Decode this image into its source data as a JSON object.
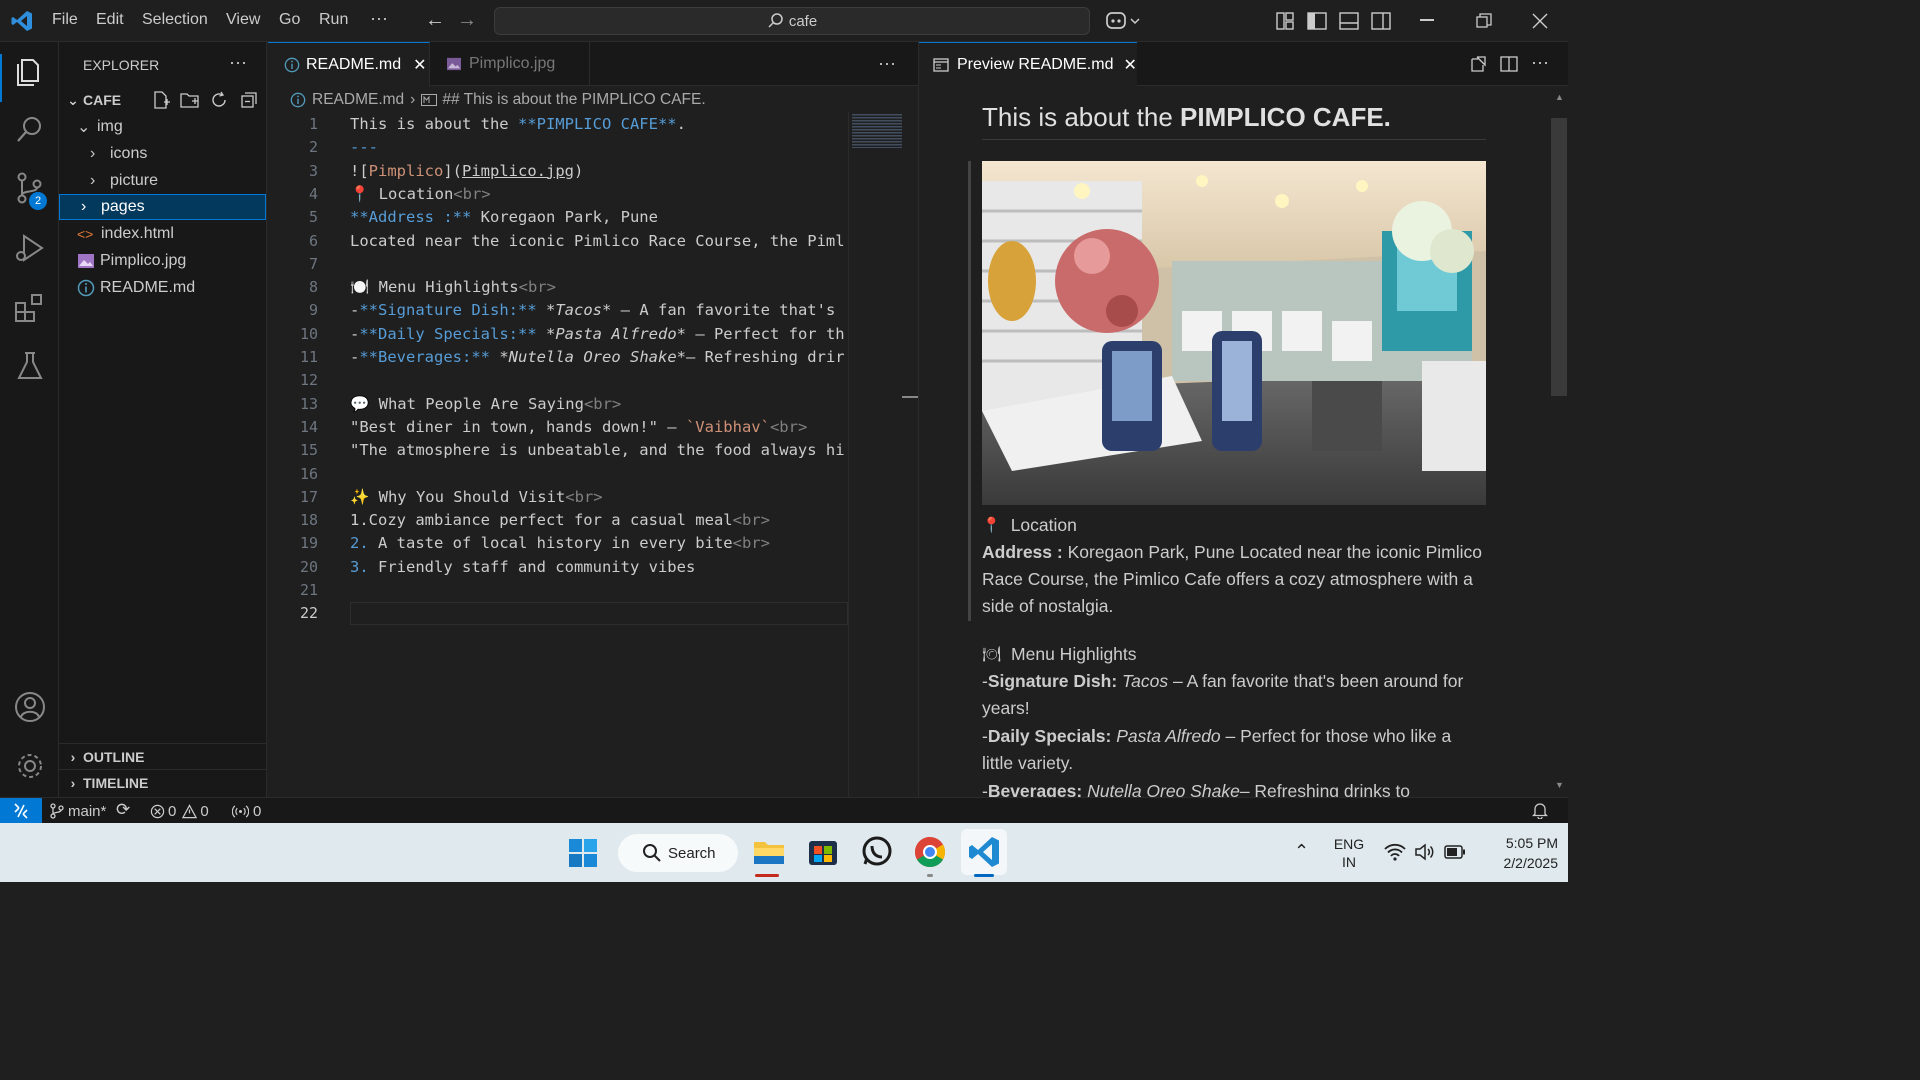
{
  "titlebar": {
    "menus": [
      "File",
      "Edit",
      "Selection",
      "View",
      "Go",
      "Run",
      "···"
    ],
    "search": "cafe"
  },
  "sidebar": {
    "title": "EXPLORER",
    "more": "···",
    "root": "CAFE",
    "items": [
      {
        "label": "img",
        "type": "folder-open"
      },
      {
        "label": "icons",
        "type": "folder"
      },
      {
        "label": "picture",
        "type": "folder"
      },
      {
        "label": "pages",
        "type": "folder",
        "selected": true
      },
      {
        "label": "index.html",
        "type": "html"
      },
      {
        "label": "Pimplico.jpg",
        "type": "image"
      },
      {
        "label": "README.md",
        "type": "info"
      }
    ],
    "outline": "OUTLINE",
    "timeline": "TIMELINE"
  },
  "tabs": [
    {
      "label": "README.md",
      "active": true
    },
    {
      "label": "Pimplico.jpg",
      "active": false
    }
  ],
  "breadcrumb": {
    "file": "README.md",
    "section": "## This is about the PIMPLICO CAFE."
  },
  "editor": {
    "line_numbers": [
      "1",
      "2",
      "3",
      "4",
      "5",
      "6",
      "7",
      "8",
      "9",
      "10",
      "11",
      "12",
      "13",
      "14",
      "15",
      "16",
      "17",
      "18",
      "19",
      "20",
      "21",
      "22"
    ],
    "lines": [
      "This is about the **PIMPLICO CAFE**.",
      "---",
      "![Pimplico](Pimplico.jpg)",
      "📍 Location<br>",
      "**Address :** Koregaon Park, Pune",
      "Located near the iconic Pimlico Race Course, the Piml",
      "",
      "🍽️ Menu Highlights<br>",
      "-**Signature Dish:** *Tacos* – A fan favorite that's",
      "-**Daily Specials:** *Pasta Alfredo* – Perfect for th",
      "-**Beverages:** *Nutella Oreo Shake*– Refreshing drir",
      "",
      "💬 What People Are Saying<br>",
      "\"Best diner in town, hands down!\" – `Vaibhav`<br>",
      "\"The atmosphere is unbeatable, and the food always hi",
      "",
      "✨ Why You Should Visit<br>",
      "1.Cozy ambiance perfect for a casual meal<br>",
      "2. A taste of local history in every bite<br>",
      "3. Friendly staff and community vibes",
      "",
      ""
    ]
  },
  "preview": {
    "tab_label": "Preview README.md",
    "heading_pre": "This is about the ",
    "heading_bold": "PIMPLICO CAFE.",
    "location": "Location",
    "address_label": "Address :",
    "address_text": " Koregaon Park, Pune Located near the iconic Pimlico Race Course, the Pimlico Cafe offers a cozy atmosphere with a side of nostalgia.",
    "menu_heading": "Menu Highlights",
    "sig_label": "Signature Dish:",
    "sig_item": "Tacos",
    "sig_text": " – A fan favorite that's been around for years!",
    "daily_label": "Daily Specials:",
    "daily_item": "Pasta Alfredo",
    "daily_text": " – Perfect for those who like a little variety.",
    "bev_label": "Beverages:",
    "bev_item": "Nutella Oreo Shake",
    "bev_text": "– Refreshing drinks to"
  },
  "statusbar": {
    "branch": "main*",
    "errors": "0",
    "warnings": "0",
    "ports": "0"
  },
  "taskbar": {
    "search": "Search",
    "lang1": "ENG",
    "lang2": "IN",
    "time": "5:05 PM",
    "date": "2/2/2025"
  }
}
